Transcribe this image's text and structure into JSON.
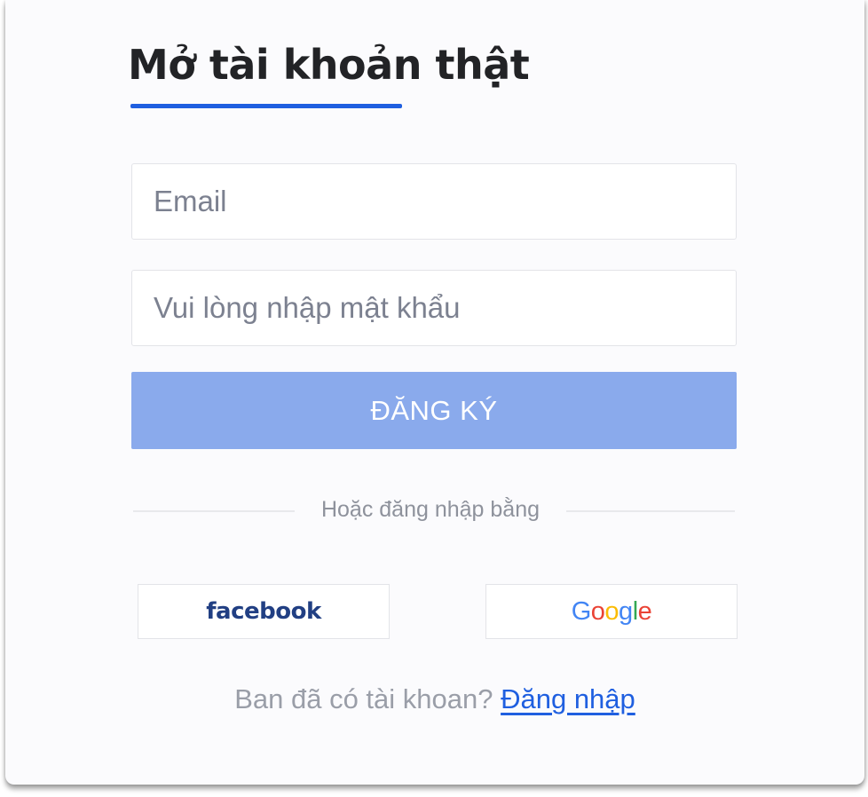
{
  "form": {
    "title": "Mở tài khoản thật",
    "email_placeholder": "Email",
    "password_placeholder": "Vui lòng nhập mật khẩu",
    "submit_label": "ĐĂNG KÝ",
    "divider_text": "Hoặc đăng nhập bằng"
  },
  "social": {
    "facebook_label": "facebook",
    "google_label": [
      "G",
      "o",
      "o",
      "g",
      "l",
      "e"
    ]
  },
  "footer": {
    "question": "Ban đã có tài khoan? ",
    "login_link": "Đăng nhập "
  },
  "colors": {
    "accent": "#1f5fe0",
    "button_bg": "#8aaaec",
    "link": "#1f5fe0",
    "facebook": "#213f83",
    "google": [
      "#4285f4",
      "#ea4335",
      "#fbbc05",
      "#4285f4",
      "#34a853",
      "#ea4335"
    ]
  }
}
